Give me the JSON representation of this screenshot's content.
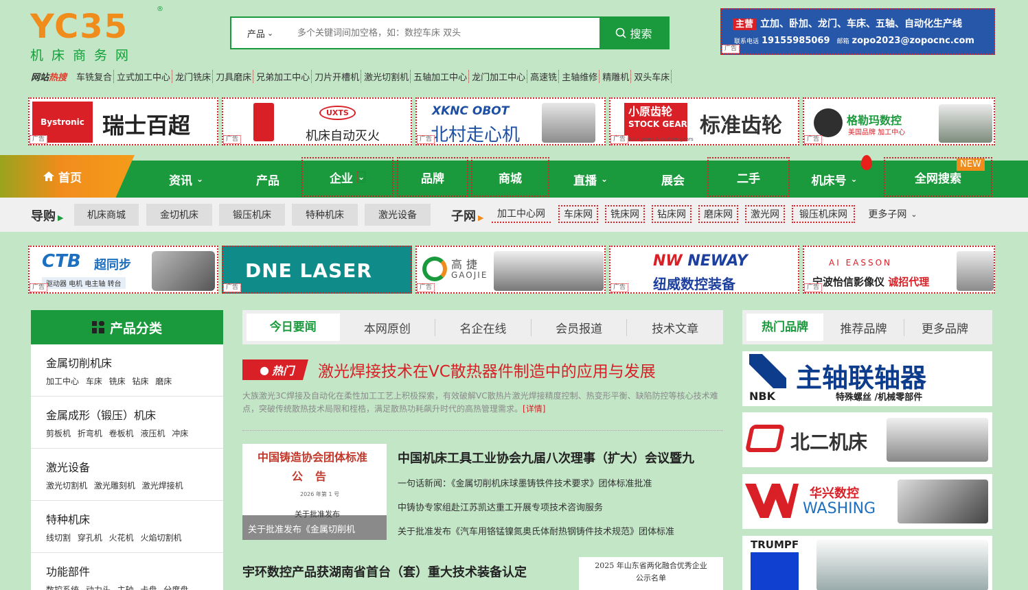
{
  "logo": {
    "mark": "YC35",
    "sub": "机床商务网",
    "reg": "®"
  },
  "search": {
    "category": "产品",
    "placeholder": "多个关键词间加空格，如：数控车床 双头",
    "button": "搜索"
  },
  "top_ad": {
    "badge": "主营",
    "line1": "立加、卧加、龙门、车床、五轴、自动化生产线",
    "phone_label": "联系电话",
    "phone": "19155985069",
    "email_label": "邮箱",
    "email": "zopo2023@zopocnc.com",
    "ad_tag": "广告"
  },
  "hot": {
    "label_a": "网站",
    "label_b": "热搜",
    "keywords": [
      "车铣复合",
      "立式加工中心",
      "龙门铣床",
      "刀具磨床",
      "兄弟加工中心",
      "刀片开槽机",
      "激光切割机",
      "五轴加工中心",
      "龙门加工中心",
      "高速铣",
      "主轴维修",
      "精雕机",
      "双头车床"
    ]
  },
  "ads_row1": [
    {
      "brand": "Bystronic",
      "name": "瑞士百超",
      "tag": "广告"
    },
    {
      "brand": "UXTS",
      "name": "机床自动灭火",
      "tag": "广告"
    },
    {
      "brand": "XKNC OBOT",
      "name": "北村走心机",
      "tag": "广告"
    },
    {
      "brand": "小原齿轮",
      "brand2": "STOCK GEARS",
      "brand3": "Stock gears & custom gears",
      "name": "标准齿轮",
      "tag": "广告"
    },
    {
      "name": "格勒玛数控",
      "sub": "美国品牌 加工中心",
      "tag": "广告"
    }
  ],
  "nav": {
    "home": "首页",
    "items": [
      "资讯",
      "产品",
      "企业",
      "品牌",
      "商城",
      "直播",
      "展会",
      "二手",
      "机床号",
      "全网搜索"
    ],
    "new_badge": "NEW"
  },
  "guide": {
    "label": "导购",
    "buttons": [
      "机床商城",
      "金切机床",
      "锻压机床",
      "特种机床",
      "激光设备"
    ],
    "sub_label": "子网",
    "links": [
      "加工中心网",
      "车床网",
      "铣床网",
      "钻床网",
      "磨床网",
      "激光网",
      "锻压机床网"
    ],
    "more": "更多子网"
  },
  "ads_row2": [
    {
      "brand": "CTB",
      "name": "超同步",
      "sub": "驱动器 电机 电主轴 转台",
      "tag": "广告"
    },
    {
      "name": "DNE LASER",
      "tag": "广告"
    },
    {
      "name": "高捷",
      "sub": "GAOJIE",
      "tag": "广告"
    },
    {
      "brand": "NEWAY",
      "name": "纽威数控装备",
      "tag": "广告"
    },
    {
      "brand": "AI EASSON",
      "name": "宁波怡信影像仪",
      "sub": "诚招代理",
      "tag": "广告"
    }
  ],
  "categories": {
    "title": "产品分类",
    "items": [
      {
        "title": "金属切削机床",
        "subs": "加工中心 车床 铣床 钻床 磨床"
      },
      {
        "title": "金属成形（锻压）机床",
        "subs": "剪板机 折弯机 卷板机 液压机 冲床"
      },
      {
        "title": "激光设备",
        "subs": "激光切割机 激光雕刻机 激光焊接机"
      },
      {
        "title": "特种机床",
        "subs": "线切割 穿孔机 火花机 火焰切割机"
      },
      {
        "title": "功能部件",
        "subs": "数控系统 动力头 主轴 卡盘 分度盘"
      }
    ]
  },
  "news": {
    "tabs": [
      "今日要闻",
      "本网原创",
      "名企在线",
      "会员报道",
      "技术文章"
    ],
    "hot_badge": "热门",
    "headline": "激光焊接技术在VC散热器件制造中的应用与发展",
    "summary": "大族激光3C焊接及自动化在柔性加工工艺上积极探索，有效破解VC散热片激光焊接精度控制、热变形平衡、缺陷防控等核心技术难点，突破传统散热技术局限和桎梏，满足散热功耗飙升时代的高热管理需求。",
    "more": "[详情]",
    "thumb": {
      "line1": "中国铸造协会团体标准",
      "line2": "公告",
      "line3": "2026 年第 1 号",
      "line4": "关于批准发布",
      "caption": "关于批准发布《金属切削机"
    },
    "title1": "中国机床工具工业协会九届八次理事（扩大）会议暨九",
    "lines": [
      "一句话新闻：《金属切削机床球墨铸铁件技术要求》团体标准批准",
      "中铸协专家组赴江苏凯达重工开展专项技术咨询服务",
      "关于批准发布《汽车用铬锰镍氮奥氏体耐热钢铸件技术规范》团体标准"
    ],
    "title2": "宇环数控产品获湖南省首台（套）重大技术装备认定",
    "thumb2": {
      "line1": "2025 年山东省两化融合优秀企业",
      "line2": "公示名单"
    }
  },
  "brands": {
    "tabs": [
      "热门品牌",
      "推荐品牌",
      "更多品牌"
    ],
    "items": [
      {
        "logo": "NBK",
        "name": "主轴联轴器",
        "sub": "特殊螺丝 /机械零部件"
      },
      {
        "name": "北二机床"
      },
      {
        "name": "华兴数控",
        "sub": "WASHING"
      },
      {
        "name": "TRUMPF"
      }
    ]
  },
  "colors": {
    "green": "#1a9a3c",
    "orange": "#f08c1c",
    "red": "#d92027",
    "bg": "#c3e6c7"
  }
}
